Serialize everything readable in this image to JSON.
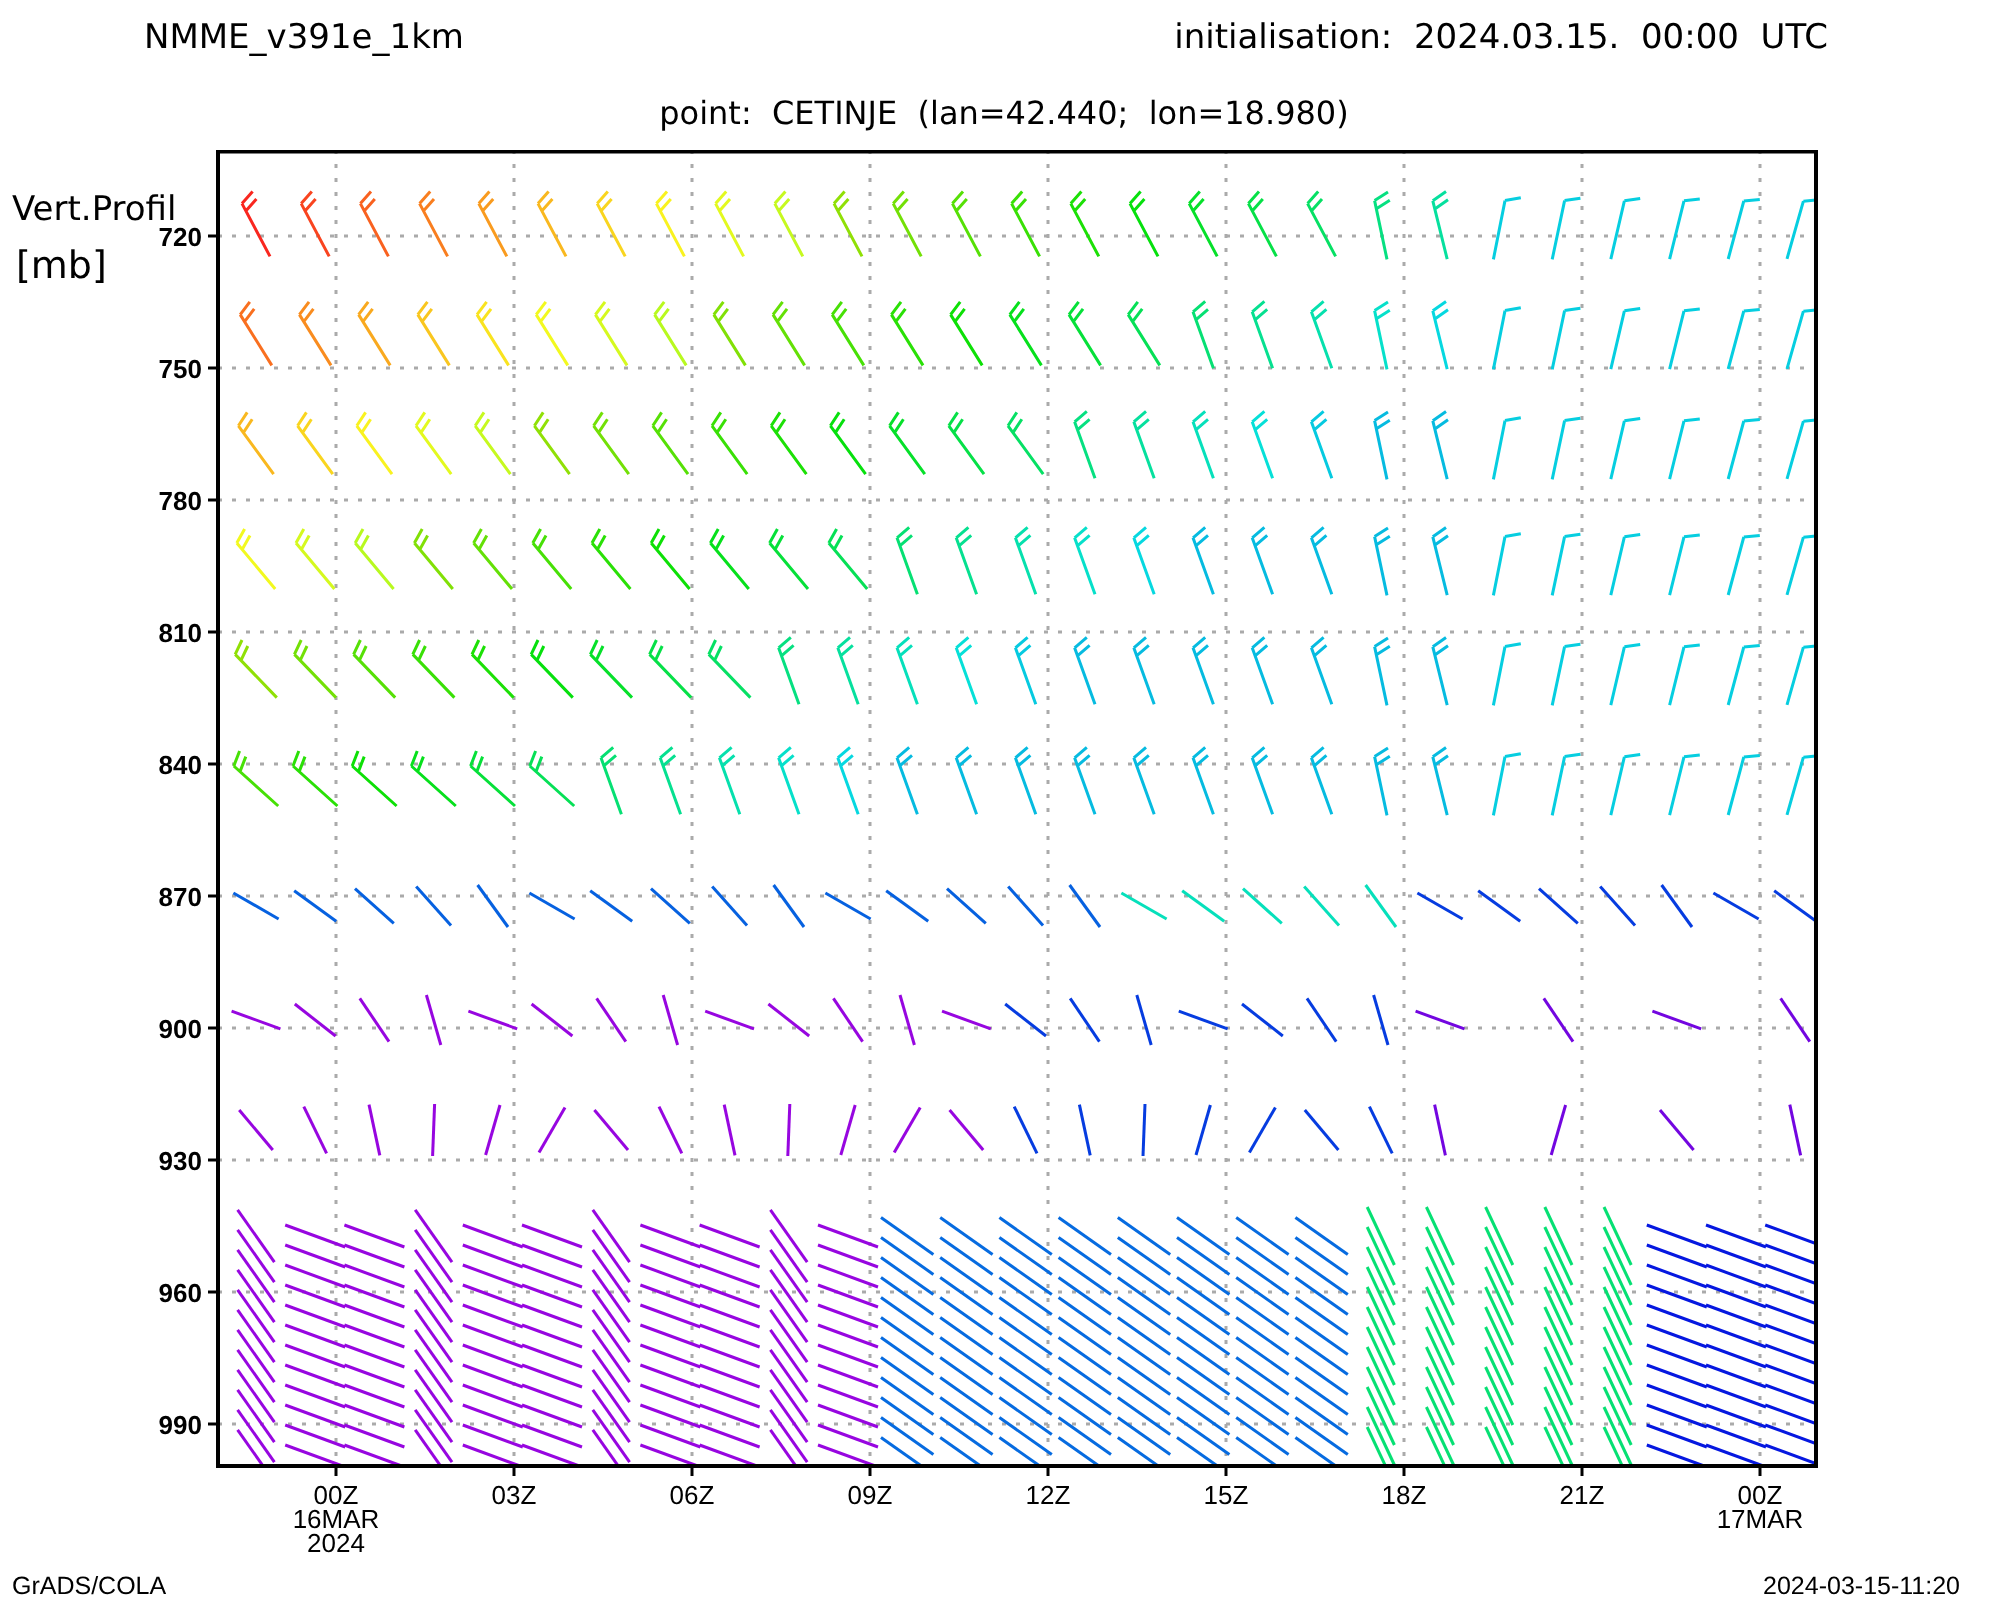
{
  "header": {
    "title": "NMME_v391e_1km",
    "initialisation": "initialisation:  2024.03.15.  00:00  UTC",
    "point": "point:  CETINJE  (lan=42.440;  lon=18.980)"
  },
  "y_axis": {
    "title_lines": [
      "Vert.Profil",
      "[mb]"
    ],
    "ticks": [
      "720",
      "750",
      "780",
      "810",
      "840",
      "870",
      "900",
      "930",
      "960",
      "990"
    ]
  },
  "x_axis": {
    "ticks": [
      {
        "lines": [
          "00Z",
          "16MAR",
          "2024"
        ]
      },
      {
        "lines": [
          "03Z"
        ]
      },
      {
        "lines": [
          "06Z"
        ]
      },
      {
        "lines": [
          "09Z"
        ]
      },
      {
        "lines": [
          "12Z"
        ]
      },
      {
        "lines": [
          "15Z"
        ]
      },
      {
        "lines": [
          "18Z"
        ]
      },
      {
        "lines": [
          "21Z"
        ]
      },
      {
        "lines": [
          "00Z",
          "17MAR"
        ]
      }
    ]
  },
  "footer": {
    "left": "GrADS/COLA",
    "right": "2024-03-15-11:20"
  }
}
